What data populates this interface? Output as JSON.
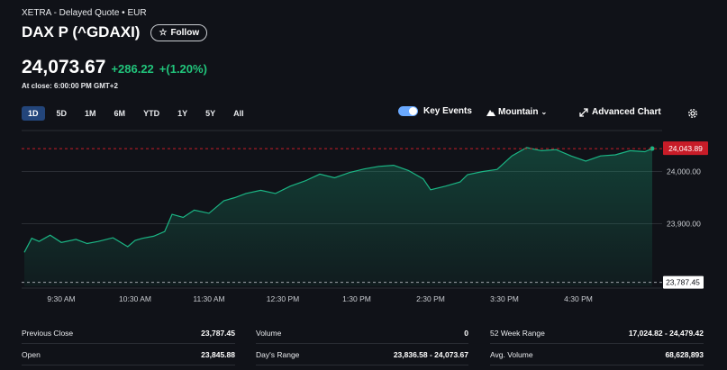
{
  "header": {
    "exchange": "XETRA - Delayed Quote • EUR",
    "title": "DAX P (^GDAXI)",
    "follow_label": "Follow"
  },
  "quote": {
    "price": "24,073.67",
    "change": "+286.22",
    "change_pct": "+(1.20%)",
    "close_time": "At close: 6:00:00 PM GMT+2"
  },
  "ranges": [
    "1D",
    "5D",
    "1M",
    "6M",
    "YTD",
    "1Y",
    "5Y",
    "All"
  ],
  "active_range": "1D",
  "tools": {
    "key_events": "Key Events",
    "key_events_on": true,
    "mountain": "Mountain",
    "advanced": "Advanced Chart",
    "icons": {
      "mountain": "mountain-icon",
      "advanced": "expand-icon",
      "settings": "gear-icon"
    }
  },
  "chart_data": {
    "type": "area",
    "x_ticks": [
      "9:30 AM",
      "10:30 AM",
      "11:30 AM",
      "12:30 PM",
      "1:30 PM",
      "2:30 PM",
      "3:30 PM",
      "4:30 PM"
    ],
    "y_ticks": [
      "24,000.00",
      "23,900.00"
    ],
    "y_values_ticks": [
      24000,
      23900
    ],
    "ylim": [
      23780,
      24070
    ],
    "current_label": "24,043.89",
    "current_value": 24043.89,
    "prev_close_label": "23,787.45",
    "prev_close_value": 23787.45,
    "x_hours": [
      9,
      9.1,
      9.2,
      9.35,
      9.5,
      9.7,
      9.85,
      10,
      10.2,
      10.4,
      10.5,
      10.6,
      10.75,
      10.9,
      11,
      11.15,
      11.3,
      11.5,
      11.7,
      11.85,
      12,
      12.2,
      12.4,
      12.6,
      12.8,
      13,
      13.2,
      13.4,
      13.6,
      13.8,
      14,
      14.2,
      14.4,
      14.5,
      14.7,
      14.9,
      15,
      15.2,
      15.4,
      15.6,
      15.8,
      16,
      16.2,
      16.4,
      16.6,
      16.8,
      17,
      17.2,
      17.4,
      17.5
    ],
    "values": [
      23845,
      23872,
      23866,
      23878,
      23864,
      23870,
      23862,
      23866,
      23873,
      23856,
      23868,
      23872,
      23876,
      23885,
      23918,
      23912,
      23926,
      23920,
      23944,
      23950,
      23958,
      23964,
      23958,
      23972,
      23982,
      23995,
      23988,
      23998,
      24005,
      24010,
      24012,
      24002,
      23986,
      23965,
      23972,
      23980,
      23994,
      24000,
      24004,
      24030,
      24046,
      24040,
      24042,
      24030,
      24020,
      24030,
      24032,
      24040,
      24038,
      24044
    ],
    "colors": {
      "line": "#1bb584",
      "prev_close": "#a0a4aa",
      "current": "#c81c28"
    }
  },
  "stats": {
    "col1": [
      {
        "label": "Previous Close",
        "value": "23,787.45"
      },
      {
        "label": "Open",
        "value": "23,845.88"
      }
    ],
    "col2": [
      {
        "label": "Volume",
        "value": "0"
      },
      {
        "label": "Day's Range",
        "value": "23,836.58 - 24,073.67"
      }
    ],
    "col3": [
      {
        "label": "52 Week Range",
        "value": "17,024.82 - 24,479.42"
      },
      {
        "label": "Avg. Volume",
        "value": "68,628,893"
      }
    ]
  }
}
